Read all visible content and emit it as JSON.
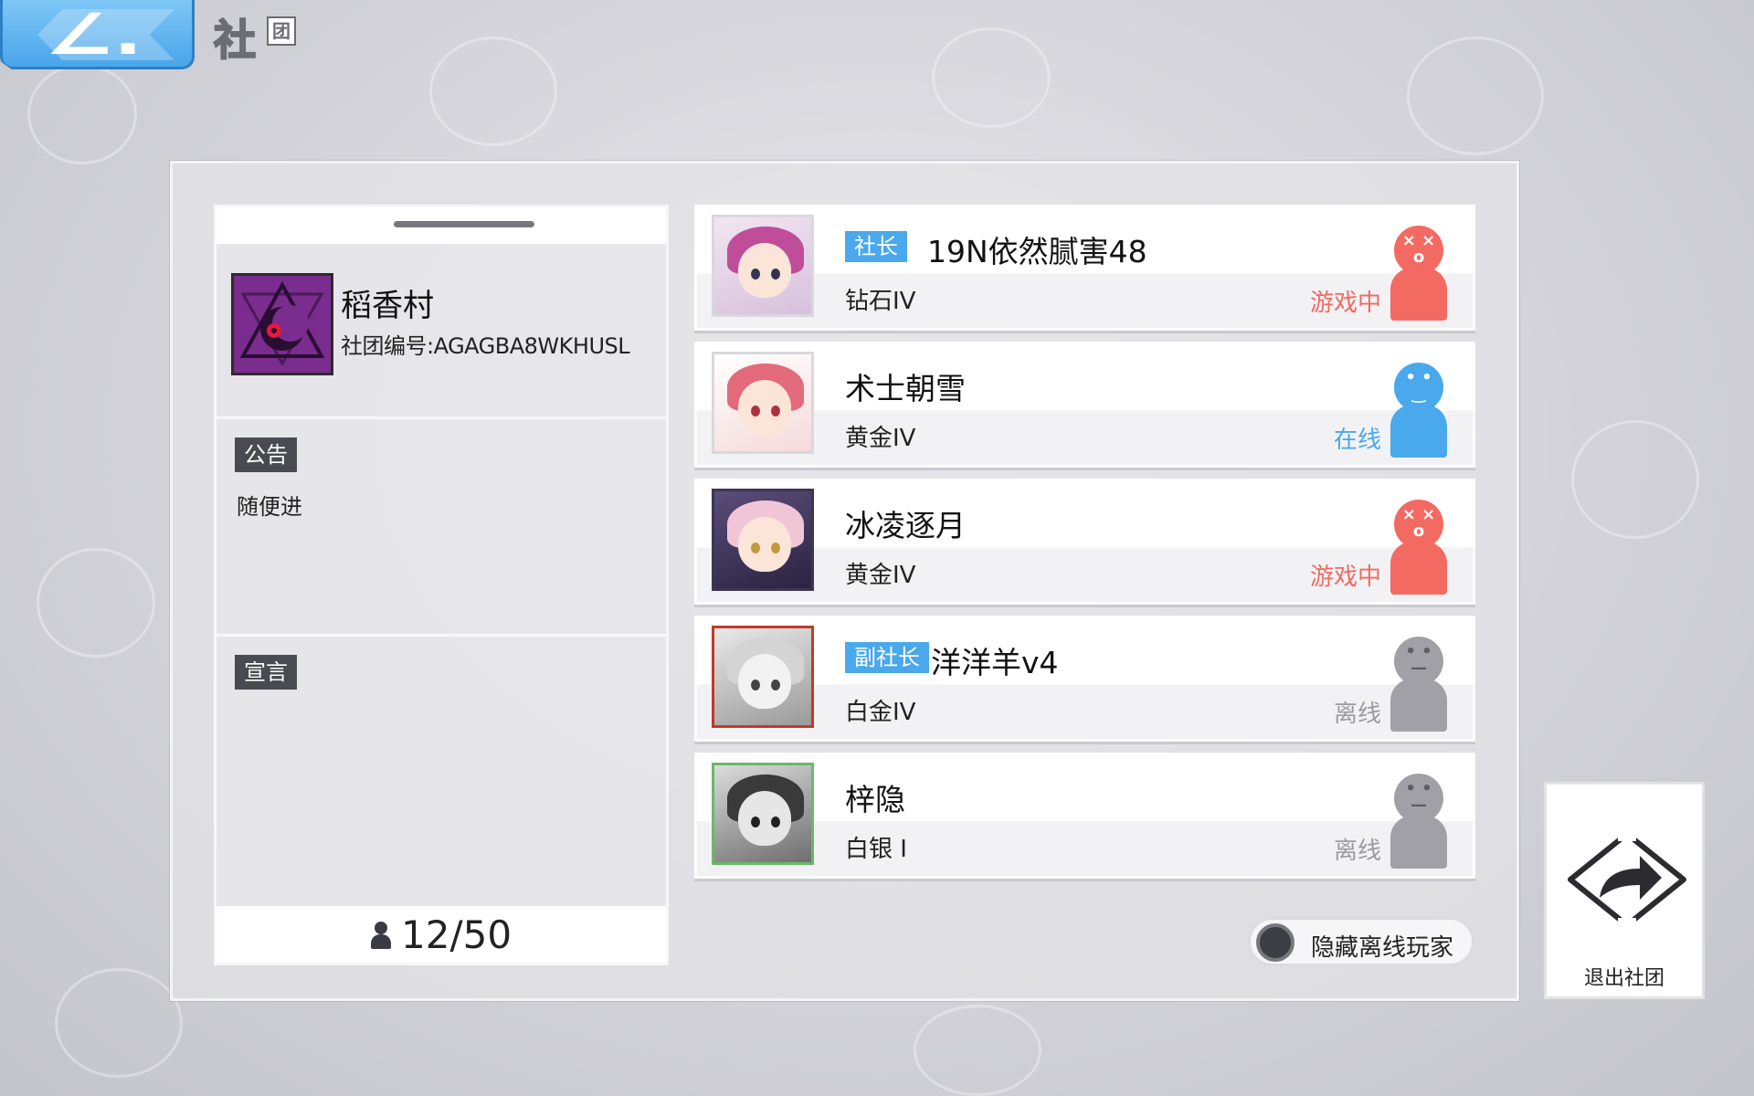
{
  "header": {
    "title": "社",
    "title_small": "团",
    "back_icon": "chevron-left-icon"
  },
  "club": {
    "name": "稻香村",
    "id_label": "社团编号:AGAGBA8WKHUSL",
    "emblem_icon": "purple-moon-eye-emblem",
    "notice_tag": "公告",
    "notice_text": "随便进",
    "declaration_tag": "宣言",
    "declaration_text": "",
    "member_count": "12/50"
  },
  "members": [
    {
      "role": "社长",
      "name": "19N依然腻害48",
      "rank": "钻石IV",
      "status": "游戏中",
      "status_color": "#f26a62",
      "state": "in-game"
    },
    {
      "role": "",
      "name": "术士朝雪",
      "rank": "黄金IV",
      "status": "在线",
      "status_color": "#4aa8ec",
      "state": "online"
    },
    {
      "role": "",
      "name": "冰凌逐月",
      "rank": "黄金IV",
      "status": "游戏中",
      "status_color": "#f26a62",
      "state": "in-game"
    },
    {
      "role": "副社长",
      "name": "洋洋羊v4",
      "rank": "白金IV",
      "status": "离线",
      "status_color": "#9a9aa2",
      "state": "offline"
    },
    {
      "role": "",
      "name": "梓隐",
      "rank": "白银 I",
      "status": "离线",
      "status_color": "#9a9aa2",
      "state": "offline"
    }
  ],
  "controls": {
    "hide_offline_label": "隐藏离线玩家",
    "leave_label": "退出社团"
  },
  "colors": {
    "accent": "#4aa8ec",
    "in_game": "#f26a62",
    "offline": "#a0a0a6"
  }
}
